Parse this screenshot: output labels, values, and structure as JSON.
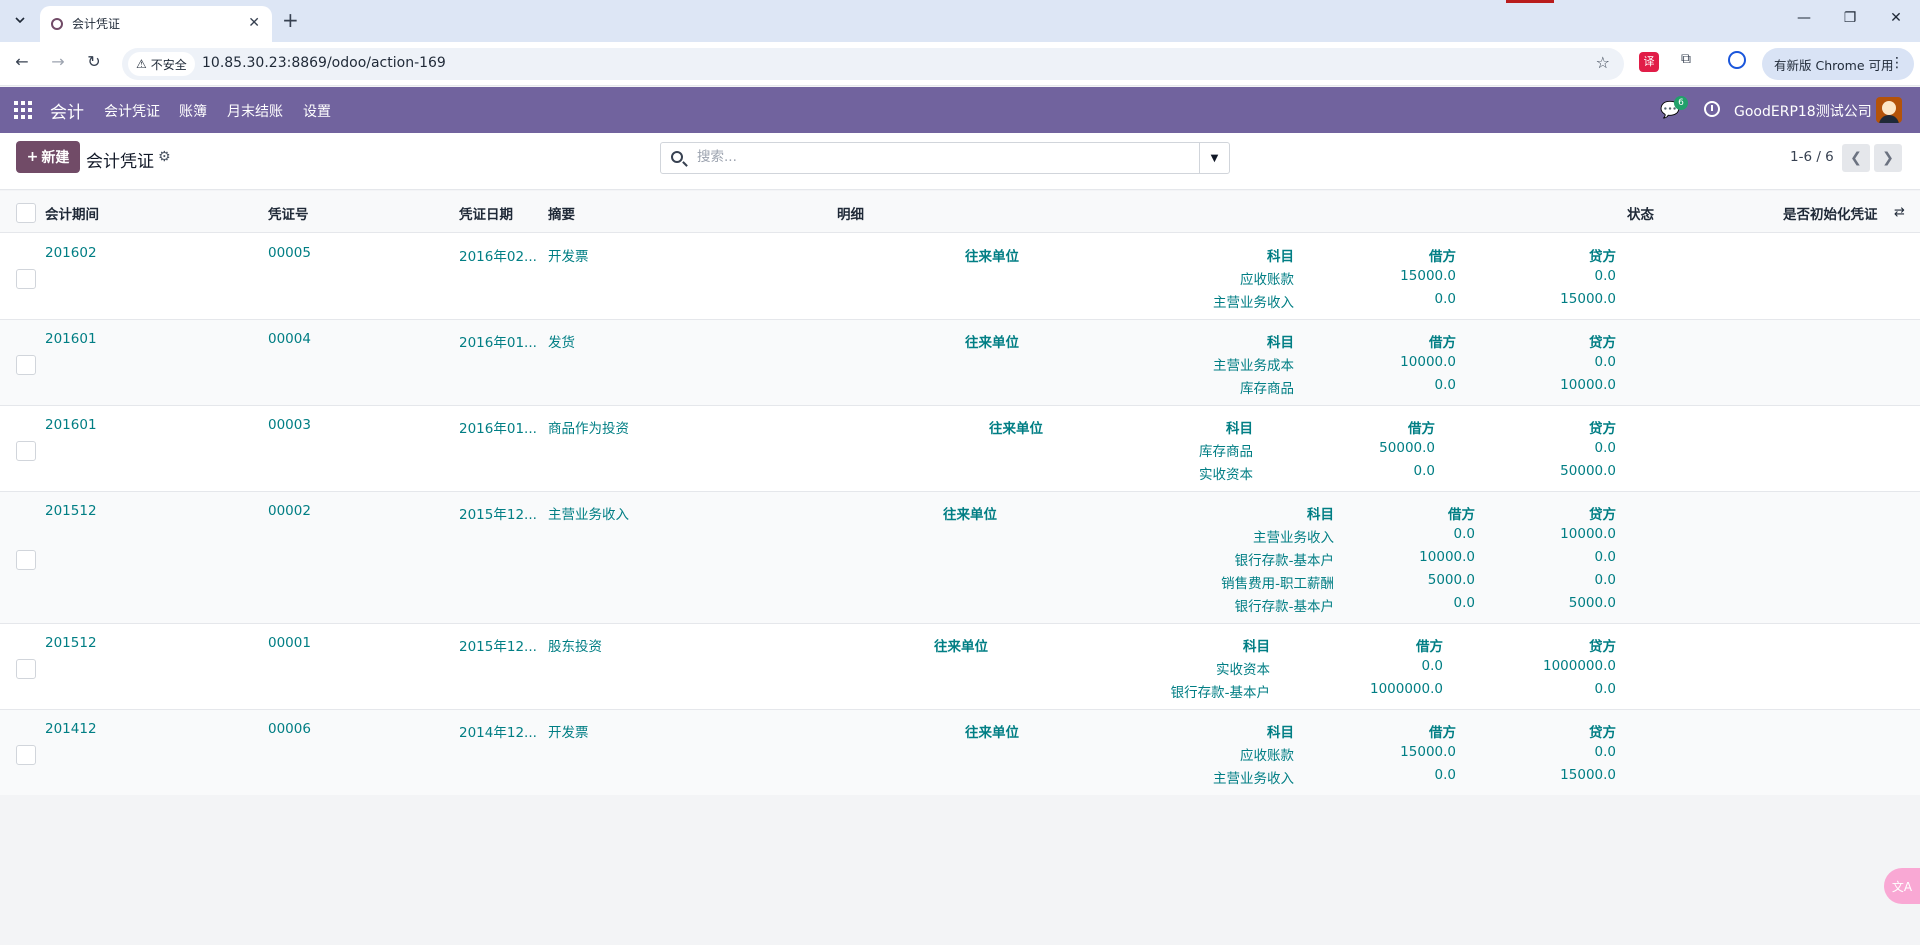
{
  "browser": {
    "tab_title": "会计凭证",
    "tab_close": "✕",
    "new_tab": "+",
    "insecure_label": "不安全",
    "url": "10.85.30.23:8869/odoo/action-169",
    "update_label": "有新版 Chrome 可用",
    "window_controls": [
      "—",
      "❐",
      "✕"
    ]
  },
  "navbar": {
    "brand": "会计",
    "menus": [
      "会计凭证",
      "账簿",
      "月末结账",
      "设置"
    ],
    "chat_badge": "6",
    "company": "GoodERP18测试公司",
    "accent_color": "#71639e"
  },
  "control_panel": {
    "new_button": "新建",
    "title": "会计凭证",
    "search_placeholder": "搜索...",
    "pager": "1-6 / 6"
  },
  "list": {
    "headers": {
      "period": "会计期间",
      "voucher_no": "凭证号",
      "date": "凭证日期",
      "summary": "摘要",
      "detail": "明细",
      "state": "状态",
      "init": "是否初始化凭证"
    },
    "sub_headers": {
      "partner": "往来单位",
      "account": "科目",
      "debit": "借方",
      "credit": "贷方"
    },
    "rows": [
      {
        "period": "201602",
        "voucher_no": "00005",
        "date": "2016年02...",
        "summary": "开发票",
        "lines": [
          {
            "account": "应收账款",
            "debit": "15000.0",
            "credit": "0.0"
          },
          {
            "account": "主营业务收入",
            "debit": "0.0",
            "credit": "15000.0"
          }
        ]
      },
      {
        "period": "201601",
        "voucher_no": "00004",
        "date": "2016年01...",
        "summary": "发货",
        "lines": [
          {
            "account": "主营业务成本",
            "debit": "10000.0",
            "credit": "0.0"
          },
          {
            "account": "库存商品",
            "debit": "0.0",
            "credit": "10000.0"
          }
        ]
      },
      {
        "period": "201601",
        "voucher_no": "00003",
        "date": "2016年01...",
        "summary": "商品作为投资",
        "lines": [
          {
            "account": "库存商品",
            "debit": "50000.0",
            "credit": "0.0"
          },
          {
            "account": "实收资本",
            "debit": "0.0",
            "credit": "50000.0"
          }
        ]
      },
      {
        "period": "201512",
        "voucher_no": "00002",
        "date": "2015年12...",
        "summary": "主营业务收入",
        "lines": [
          {
            "account": "主营业务收入",
            "debit": "0.0",
            "credit": "10000.0"
          },
          {
            "account": "银行存款-基本户",
            "debit": "10000.0",
            "credit": "0.0"
          },
          {
            "account": "销售费用-职工薪酬",
            "debit": "5000.0",
            "credit": "0.0"
          },
          {
            "account": "银行存款-基本户",
            "debit": "0.0",
            "credit": "5000.0"
          }
        ]
      },
      {
        "period": "201512",
        "voucher_no": "00001",
        "date": "2015年12...",
        "summary": "股东投资",
        "lines": [
          {
            "account": "实收资本",
            "debit": "0.0",
            "credit": "1000000.0"
          },
          {
            "account": "银行存款-基本户",
            "debit": "1000000.0",
            "credit": "0.0"
          }
        ]
      },
      {
        "period": "201412",
        "voucher_no": "00006",
        "date": "2014年12...",
        "summary": "开发票",
        "lines": [
          {
            "account": "应收账款",
            "debit": "15000.0",
            "credit": "0.0"
          },
          {
            "account": "主营业务收入",
            "debit": "0.0",
            "credit": "15000.0"
          }
        ]
      }
    ]
  },
  "colors": {
    "link": "#017e84",
    "primary_button": "#714b67"
  }
}
